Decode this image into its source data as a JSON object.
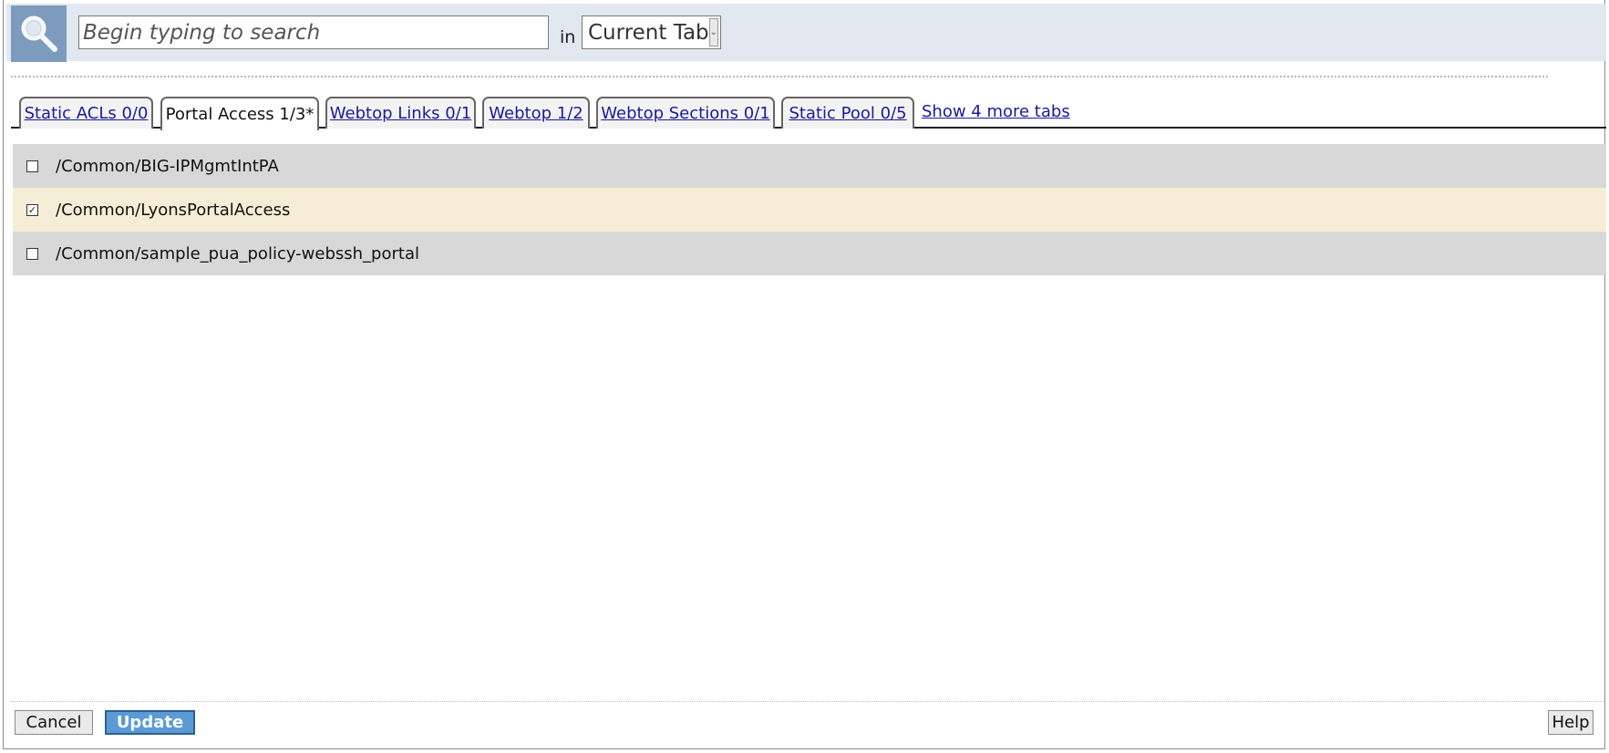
{
  "search": {
    "placeholder": "Begin typing to search",
    "in_label": "in",
    "scope_selected": "Current Tab"
  },
  "tabs": [
    {
      "label": "Static ACLs 0/0",
      "active": false
    },
    {
      "label": "Portal Access 1/3*",
      "active": true
    },
    {
      "label": "Webtop Links 0/1",
      "active": false
    },
    {
      "label": "Webtop 1/2",
      "active": false
    },
    {
      "label": "Webtop Sections 0/1",
      "active": false
    },
    {
      "label": "Static Pool 0/5",
      "active": false
    }
  ],
  "more_tabs_label": "Show 4 more tabs",
  "items": [
    {
      "name": "/Common/BIG-IPMgmtIntPA",
      "checked": false
    },
    {
      "name": "/Common/LyonsPortalAccess",
      "checked": true
    },
    {
      "name": "/Common/sample_pua_policy-webssh_portal",
      "checked": false
    }
  ],
  "footer": {
    "cancel_label": "Cancel",
    "update_label": "Update",
    "help_label": "Help"
  },
  "colors": {
    "search_bar_bg": "#e1e8ef",
    "search_icon_bg": "#7d9bbd",
    "row_bg": "#d8d8d8",
    "row_selected_bg": "#f6edd6",
    "link": "#1a1a9c",
    "update_button": "#5b9ad6"
  }
}
